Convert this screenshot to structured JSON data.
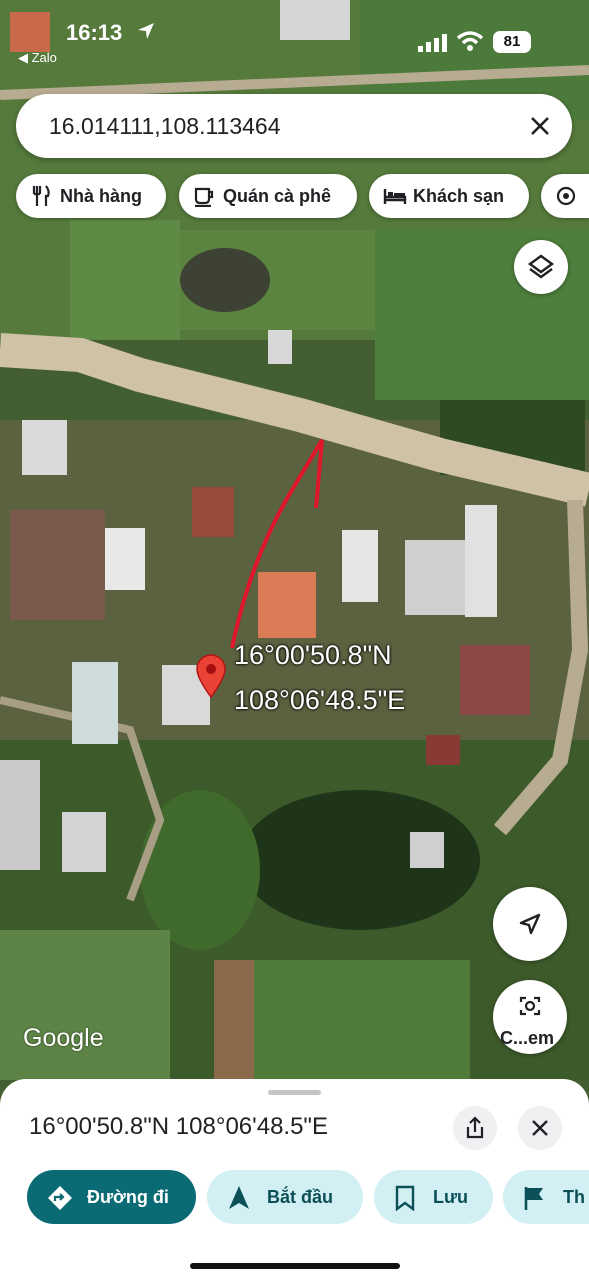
{
  "status_bar": {
    "time": "16:13",
    "back_app": "◀ Zalo",
    "battery": "81"
  },
  "search": {
    "value": "16.014111,108.113464"
  },
  "chips": [
    {
      "label": "Nhà hàng",
      "icon": "fork-knife-icon"
    },
    {
      "label": "Quán cà phê",
      "icon": "coffee-cup-icon"
    },
    {
      "label": "Khách sạn",
      "icon": "bed-icon"
    },
    {
      "label": "",
      "icon": "attraction-icon"
    }
  ],
  "map": {
    "pin_latitude_dms": "16°00'50.8\"N",
    "pin_longitude_dms": "108°06'48.5\"E",
    "attribution": "Google",
    "lens_label": "C...em",
    "colors": {
      "pin": "#ea4335",
      "annotation_arrow": "#e0162b",
      "road": "#cfc2a7"
    }
  },
  "sheet": {
    "title": "16°00'50.8\"N 108°06'48.5\"E",
    "actions": [
      {
        "label": "Đường đi",
        "icon": "directions-icon",
        "primary": true
      },
      {
        "label": "Bắt đầu",
        "icon": "navigation-arrow-icon",
        "primary": false
      },
      {
        "label": "Lưu",
        "icon": "bookmark-icon",
        "primary": false
      },
      {
        "label": "Th",
        "icon": "flag-icon",
        "primary": false
      }
    ],
    "colors": {
      "primary": "#0b6b75",
      "secondary": "#d2f0f3",
      "secondary_text": "#0b4f57"
    }
  }
}
